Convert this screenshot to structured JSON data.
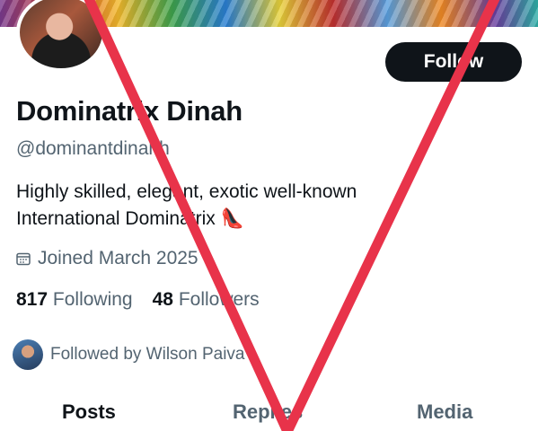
{
  "profile": {
    "name": "Dominatrix Dinah",
    "handle": "@dominantdinahh",
    "bio_line1": "Highly skilled, elegant, exotic well-known",
    "bio_line2": "International Dominatrix",
    "bio_emoji": "👠",
    "joined": "Joined March 2025"
  },
  "stats": {
    "following_count": "817",
    "following_label": "Following",
    "followers_count": "48",
    "followers_label": "Followers"
  },
  "followed_by": "Followed by Wilson Paiva",
  "buttons": {
    "follow": "Follow"
  },
  "tabs": [
    "Posts",
    "Replies",
    "Media"
  ],
  "colors": {
    "overlay_x": "#e8334a",
    "primary_text": "#0f1419",
    "secondary_text": "#536471"
  },
  "icons": {
    "joined": "calendar-icon"
  }
}
